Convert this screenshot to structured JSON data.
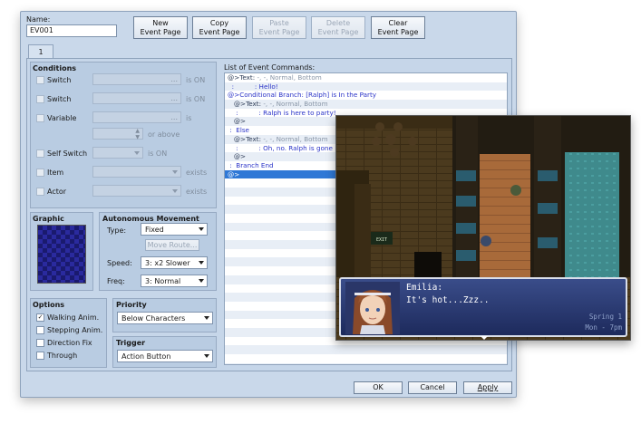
{
  "editor": {
    "name_label": "Name:",
    "name_value": "EV001",
    "buttons": {
      "new_page": "New\nEvent Page",
      "copy_page": "Copy\nEvent Page",
      "paste_page": "Paste\nEvent Page",
      "delete_page": "Delete\nEvent Page",
      "clear_page": "Clear\nEvent Page"
    },
    "page_tab": "1",
    "conditions": {
      "title": "Conditions",
      "switch1": "Switch",
      "switch1_suffix": "is ON",
      "switch2": "Switch",
      "switch2_suffix": "is ON",
      "variable": "Variable",
      "variable_suffix": "is",
      "variable_or_above": "or above",
      "self_switch": "Self Switch",
      "self_switch_suffix": "is ON",
      "item": "Item",
      "item_suffix": "exists",
      "actor": "Actor",
      "actor_suffix": "exists",
      "dots": "..."
    },
    "graphic": {
      "title": "Graphic"
    },
    "autonomous": {
      "title": "Autonomous Movement",
      "type_label": "Type:",
      "type_value": "Fixed",
      "move_route": "Move Route...",
      "speed_label": "Speed:",
      "speed_value": "3: x2 Slower",
      "freq_label": "Freq:",
      "freq_value": "3: Normal"
    },
    "options": {
      "title": "Options",
      "walking": "Walking Anim.",
      "walking_checked": true,
      "stepping": "Stepping Anim.",
      "direction_fix": "Direction Fix",
      "through": "Through",
      "check_mark": "✓"
    },
    "priority": {
      "title": "Priority",
      "value": "Below Characters"
    },
    "trigger": {
      "title": "Trigger",
      "value": "Action Button"
    },
    "list_title": "List of Event Commands:",
    "commands": [
      {
        "a": "@>Text: ",
        "b": "-, -, Normal, Bottom",
        "style": "text"
      },
      {
        "a": "  :          : Hello!",
        "b": "",
        "style": "blue"
      },
      {
        "a": "@>Conditional Branch: [Ralph] is In the Party",
        "b": "",
        "style": "blue"
      },
      {
        "a": "   @>Text: ",
        "b": "-, -, Normal, Bottom",
        "style": "text"
      },
      {
        "a": "    :          : Ralph is here to party!",
        "b": "",
        "style": "blue"
      },
      {
        "a": "   @>",
        "b": "",
        "style": "text"
      },
      {
        "a": " :  Else",
        "b": "",
        "style": "blue"
      },
      {
        "a": "   @>Text: ",
        "b": "-, -, Normal, Bottom",
        "style": "text"
      },
      {
        "a": "    :          : Oh, no. Ralph is gone",
        "b": "",
        "style": "blue"
      },
      {
        "a": "   @>",
        "b": "",
        "style": "text"
      },
      {
        "a": " :  Branch End",
        "b": "",
        "style": "blue"
      },
      {
        "a": "@>",
        "b": "",
        "style": "sel"
      }
    ],
    "footer": {
      "ok": "OK",
      "cancel": "Cancel",
      "apply": "Apply"
    }
  },
  "game": {
    "speaker": "Emilia:",
    "line": "It's hot...Zzz..",
    "season": "Spring  1",
    "time": "Mon - 7pm",
    "sign": "EXIT"
  }
}
